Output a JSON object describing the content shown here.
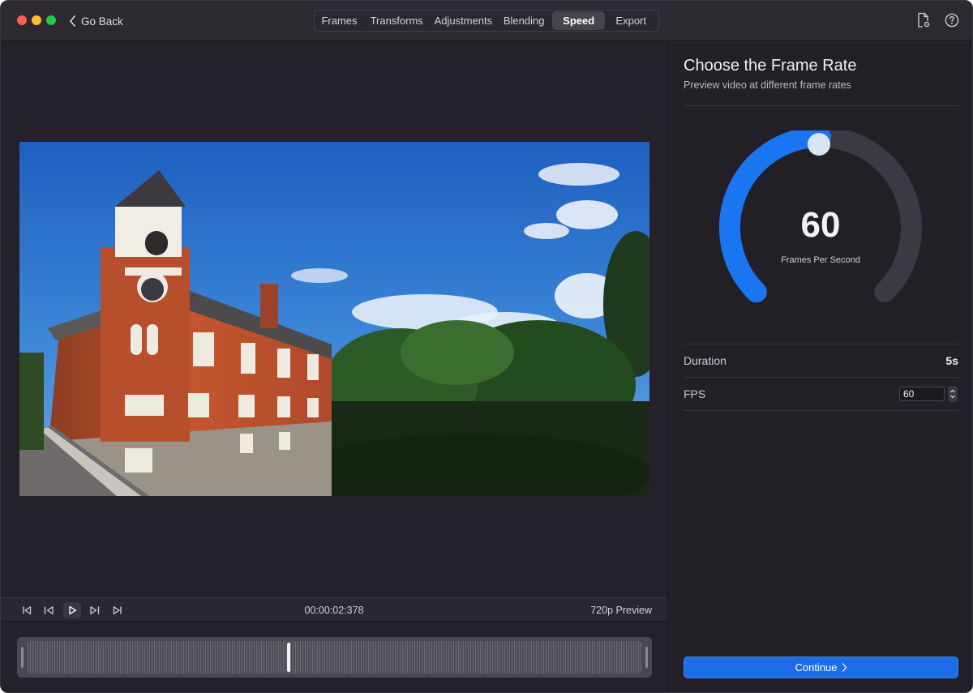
{
  "titlebar": {
    "back_label": "Go Back",
    "tabs": [
      {
        "label": "Frames",
        "active": false
      },
      {
        "label": "Transforms",
        "active": false
      },
      {
        "label": "Adjustments",
        "active": false
      },
      {
        "label": "Blending",
        "active": false
      },
      {
        "label": "Speed",
        "active": true
      },
      {
        "label": "Export",
        "active": false
      }
    ],
    "icons": [
      "file-gear-icon",
      "help-icon"
    ]
  },
  "preview": {
    "image_description": "Red brick building with white clock tower beside green trees under blue sky",
    "timecode": "00:00:02:378",
    "quality": "720p Preview",
    "playhead_position": 0.42
  },
  "panel": {
    "title": "Choose the Frame Rate",
    "subtitle": "Preview video at different frame rates",
    "dial": {
      "value": "60",
      "unit_label": "Frames Per Second",
      "fill_fraction": 0.5
    },
    "duration": {
      "label": "Duration",
      "value": "5s"
    },
    "fps": {
      "label": "FPS",
      "value": "60"
    },
    "continue_label": "Continue"
  },
  "colors": {
    "accent": "#1d6de8",
    "dial_fill": "#1a75f0",
    "dial_track": "#3c3942",
    "background": "#23202a"
  }
}
